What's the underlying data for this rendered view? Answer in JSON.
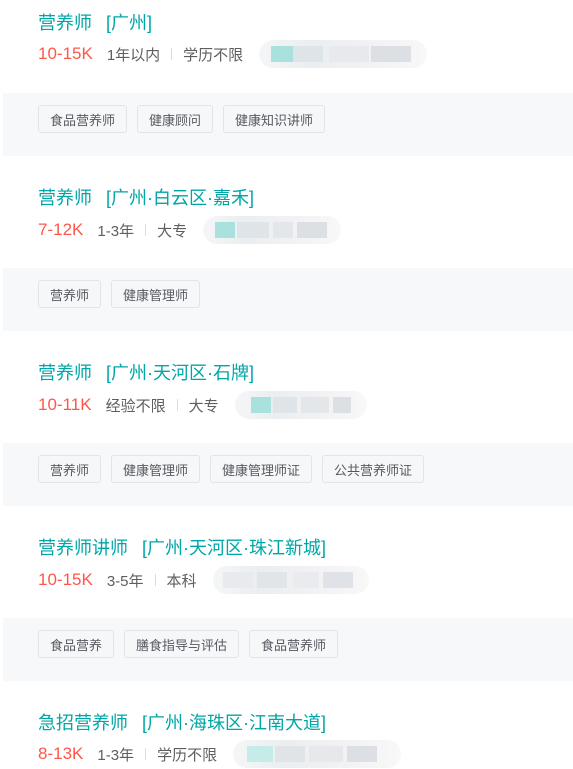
{
  "jobs": [
    {
      "title": "营养师",
      "location": "[广州]",
      "salary": "10-15K",
      "experience": "1年以内",
      "education": "学历不限",
      "tags": [
        "食品营养师",
        "健康顾问",
        "健康知识讲师"
      ]
    },
    {
      "title": "营养师",
      "location": "[广州·白云区·嘉禾]",
      "salary": "7-12K",
      "experience": "1-3年",
      "education": "大专",
      "tags": [
        "营养师",
        "健康管理师"
      ]
    },
    {
      "title": "营养师",
      "location": "[广州·天河区·石牌]",
      "salary": "10-11K",
      "experience": "经验不限",
      "education": "大专",
      "tags": [
        "营养师",
        "健康管理师",
        "健康管理师证",
        "公共营养师证"
      ]
    },
    {
      "title": "营养师讲师",
      "location": "[广州·天河区·珠江新城]",
      "salary": "10-15K",
      "experience": "3-5年",
      "education": "本科",
      "tags": [
        "食品营养",
        "膳食指导与评估",
        "食品营养师"
      ]
    },
    {
      "title": "急招营养师",
      "location": "[广州·海珠区·江南大道]",
      "salary": "8-13K",
      "experience": "1-3年",
      "education": "学历不限",
      "tags": []
    }
  ]
}
